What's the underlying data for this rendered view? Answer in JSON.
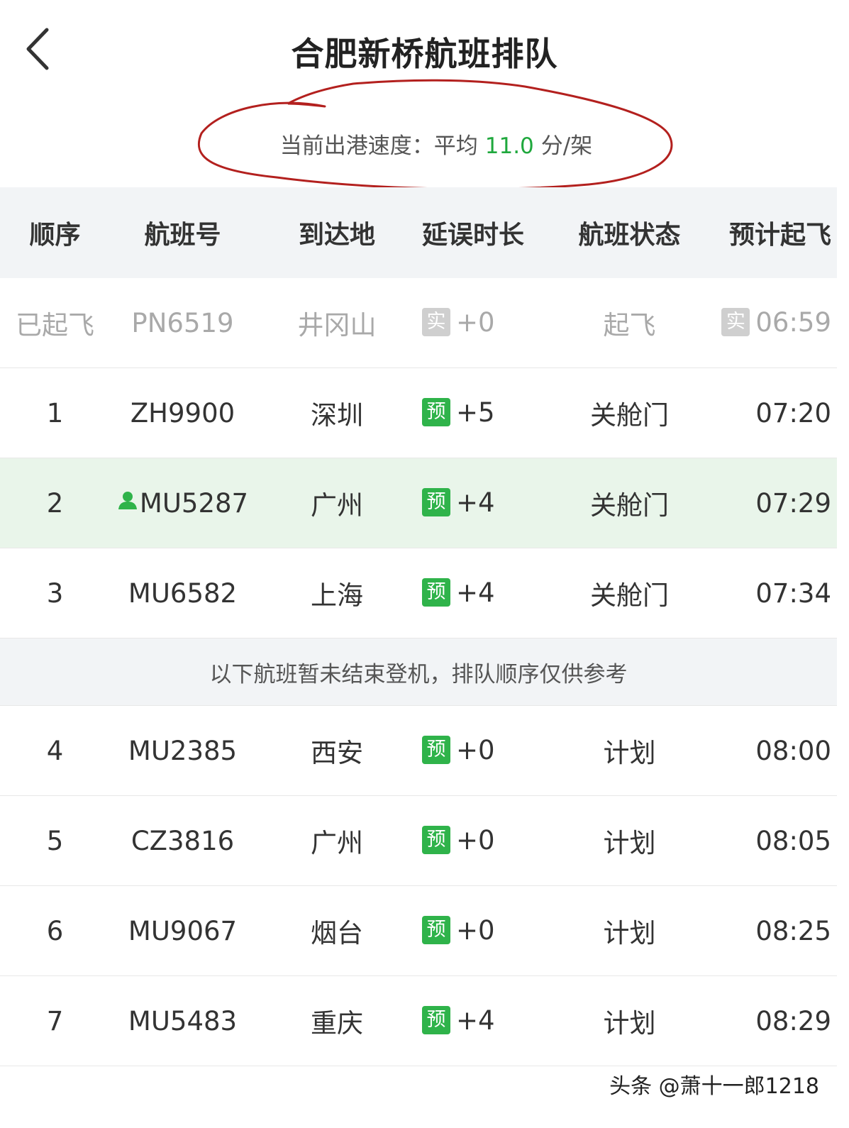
{
  "header": {
    "title": "合肥新桥航班排队",
    "speed_prefix": "当前出港速度：平均",
    "speed_value": "11.0",
    "speed_unit": "分/架"
  },
  "table": {
    "columns": [
      "顺序",
      "航班号",
      "到达地",
      "延误时长",
      "航班状态",
      "预计起飞"
    ],
    "departed_row": {
      "seq": "已起飞",
      "flight": "PN6519",
      "dest": "井冈山",
      "badge": "实",
      "delay": "+0",
      "status": "起飞",
      "time_badge": "实",
      "time": "06:59"
    },
    "rows_before_notice": [
      {
        "seq": "1",
        "flight": "ZH9900",
        "dest": "深圳",
        "badge": "预",
        "delay": "+5",
        "status": "关舱门",
        "time": "07:20"
      },
      {
        "seq": "2",
        "flight": "MU5287",
        "dest": "广州",
        "badge": "预",
        "delay": "+4",
        "status": "关舱门",
        "time": "07:29"
      },
      {
        "seq": "3",
        "flight": "MU6582",
        "dest": "上海",
        "badge": "预",
        "delay": "+4",
        "status": "关舱门",
        "time": "07:34"
      }
    ],
    "notice": "以下航班暂未结束登机，排队顺序仅供参考",
    "rows_after_notice": [
      {
        "seq": "4",
        "flight": "MU2385",
        "dest": "西安",
        "badge": "预",
        "delay": "+0",
        "status": "计划",
        "time": "08:00"
      },
      {
        "seq": "5",
        "flight": "CZ3816",
        "dest": "广州",
        "badge": "预",
        "delay": "+0",
        "status": "计划",
        "time": "08:05"
      },
      {
        "seq": "6",
        "flight": "MU9067",
        "dest": "烟台",
        "badge": "预",
        "delay": "+0",
        "status": "计划",
        "time": "08:25"
      },
      {
        "seq": "7",
        "flight": "MU5483",
        "dest": "重庆",
        "badge": "预",
        "delay": "+4",
        "status": "计划",
        "time": "08:29"
      }
    ]
  },
  "watermark": "头条 @萧十一郎1218",
  "colors": {
    "accent_green": "#1fa83d",
    "badge_green": "#2fb34a",
    "badge_gray": "#cfcfcf",
    "highlight_row": "#e9f5ea",
    "annotation_red": "#b3201e"
  },
  "icons": {
    "back": "chevron-left-icon",
    "my_flight": "person-icon"
  }
}
